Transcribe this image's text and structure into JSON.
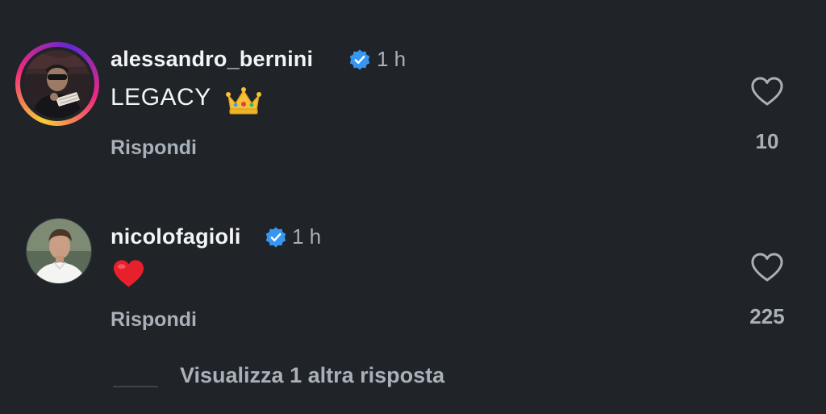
{
  "comments": [
    {
      "username": "alessandro_bernini",
      "verified": true,
      "time": "1 h",
      "text": "LEGACY",
      "emoji": "crown",
      "reply_label": "Rispondi",
      "likes": "10",
      "has_story_ring": true
    },
    {
      "username": "nicolofagioli",
      "verified": true,
      "time": "1 h",
      "text": "",
      "emoji": "red-heart",
      "reply_label": "Rispondi",
      "likes": "225",
      "has_story_ring": false
    }
  ],
  "view_more": {
    "label": "Visualizza 1 altra risposta"
  },
  "colors": {
    "background": "#202327",
    "text_primary": "#f2f4f6",
    "text_secondary": "#a8b0b9",
    "verified_blue": "#3797f0"
  },
  "icons": {
    "like": "heart-outline-icon",
    "verified": "verified-badge-icon"
  }
}
